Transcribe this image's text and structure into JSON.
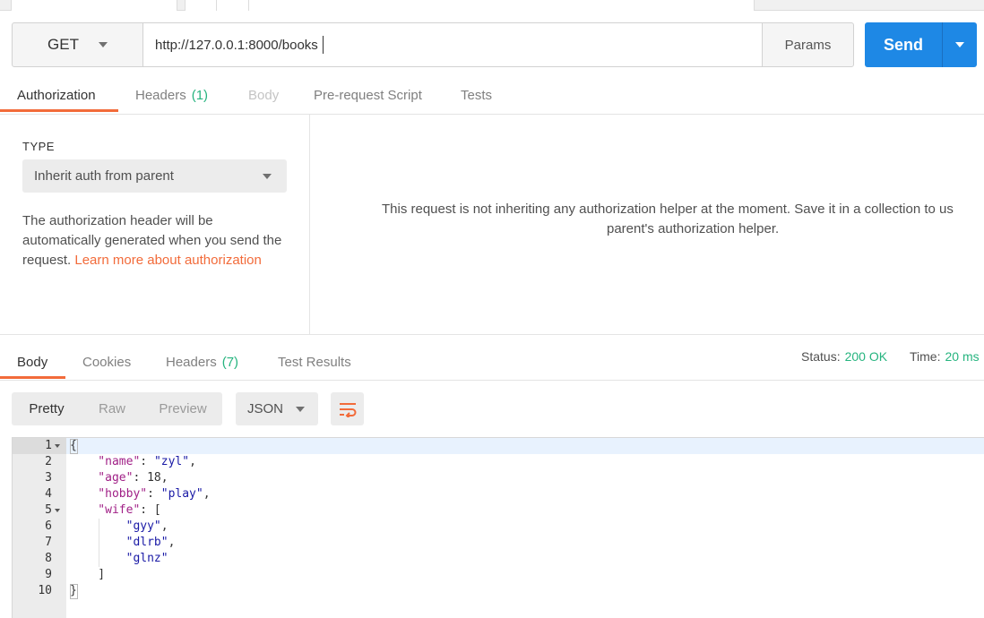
{
  "request": {
    "method": "GET",
    "url": "http://127.0.0.1:8000/books",
    "params_label": "Params",
    "send_label": "Send"
  },
  "request_tabs": [
    {
      "label": "Authorization",
      "count": ""
    },
    {
      "label": "Headers",
      "count": "(1)"
    },
    {
      "label": "Body",
      "count": ""
    },
    {
      "label": "Pre-request Script",
      "count": ""
    },
    {
      "label": "Tests",
      "count": ""
    }
  ],
  "auth": {
    "type_label": "TYPE",
    "type_value": "Inherit auth from parent",
    "description": "The authorization header will be automatically generated when you send the request.",
    "learn_more": "Learn more about authorization",
    "message_line1": "This request is not inheriting any authorization helper at the moment. Save it in a collection to us",
    "message_line2": "parent's authorization helper."
  },
  "response_tabs": [
    {
      "label": "Body",
      "count": ""
    },
    {
      "label": "Cookies",
      "count": ""
    },
    {
      "label": "Headers",
      "count": "(7)"
    },
    {
      "label": "Test Results",
      "count": ""
    }
  ],
  "status": {
    "status_label": "Status:",
    "status_value": "200 OK",
    "time_label": "Time:",
    "time_value": "20 ms"
  },
  "format": {
    "modes": [
      "Pretty",
      "Raw",
      "Preview"
    ],
    "active_mode": "Pretty",
    "language": "JSON"
  },
  "colors": {
    "accent": "#f26b3a",
    "send": "#1e88e5",
    "success": "#26b47f"
  },
  "editor": {
    "line_numbers": [
      "1",
      "2",
      "3",
      "4",
      "5",
      "6",
      "7",
      "8",
      "9",
      "10"
    ],
    "lines": [
      "{",
      "    \"name\": \"zyl\",",
      "    \"age\": 18,",
      "    \"hobby\": \"play\",",
      "    \"wife\": [",
      "        \"gyy\",",
      "        \"dlrb\",",
      "        \"glnz\"",
      "    ]",
      "}"
    ]
  },
  "icons": {
    "wrap": "wrap-lines-icon",
    "dropdown": "chevron-down-icon"
  }
}
